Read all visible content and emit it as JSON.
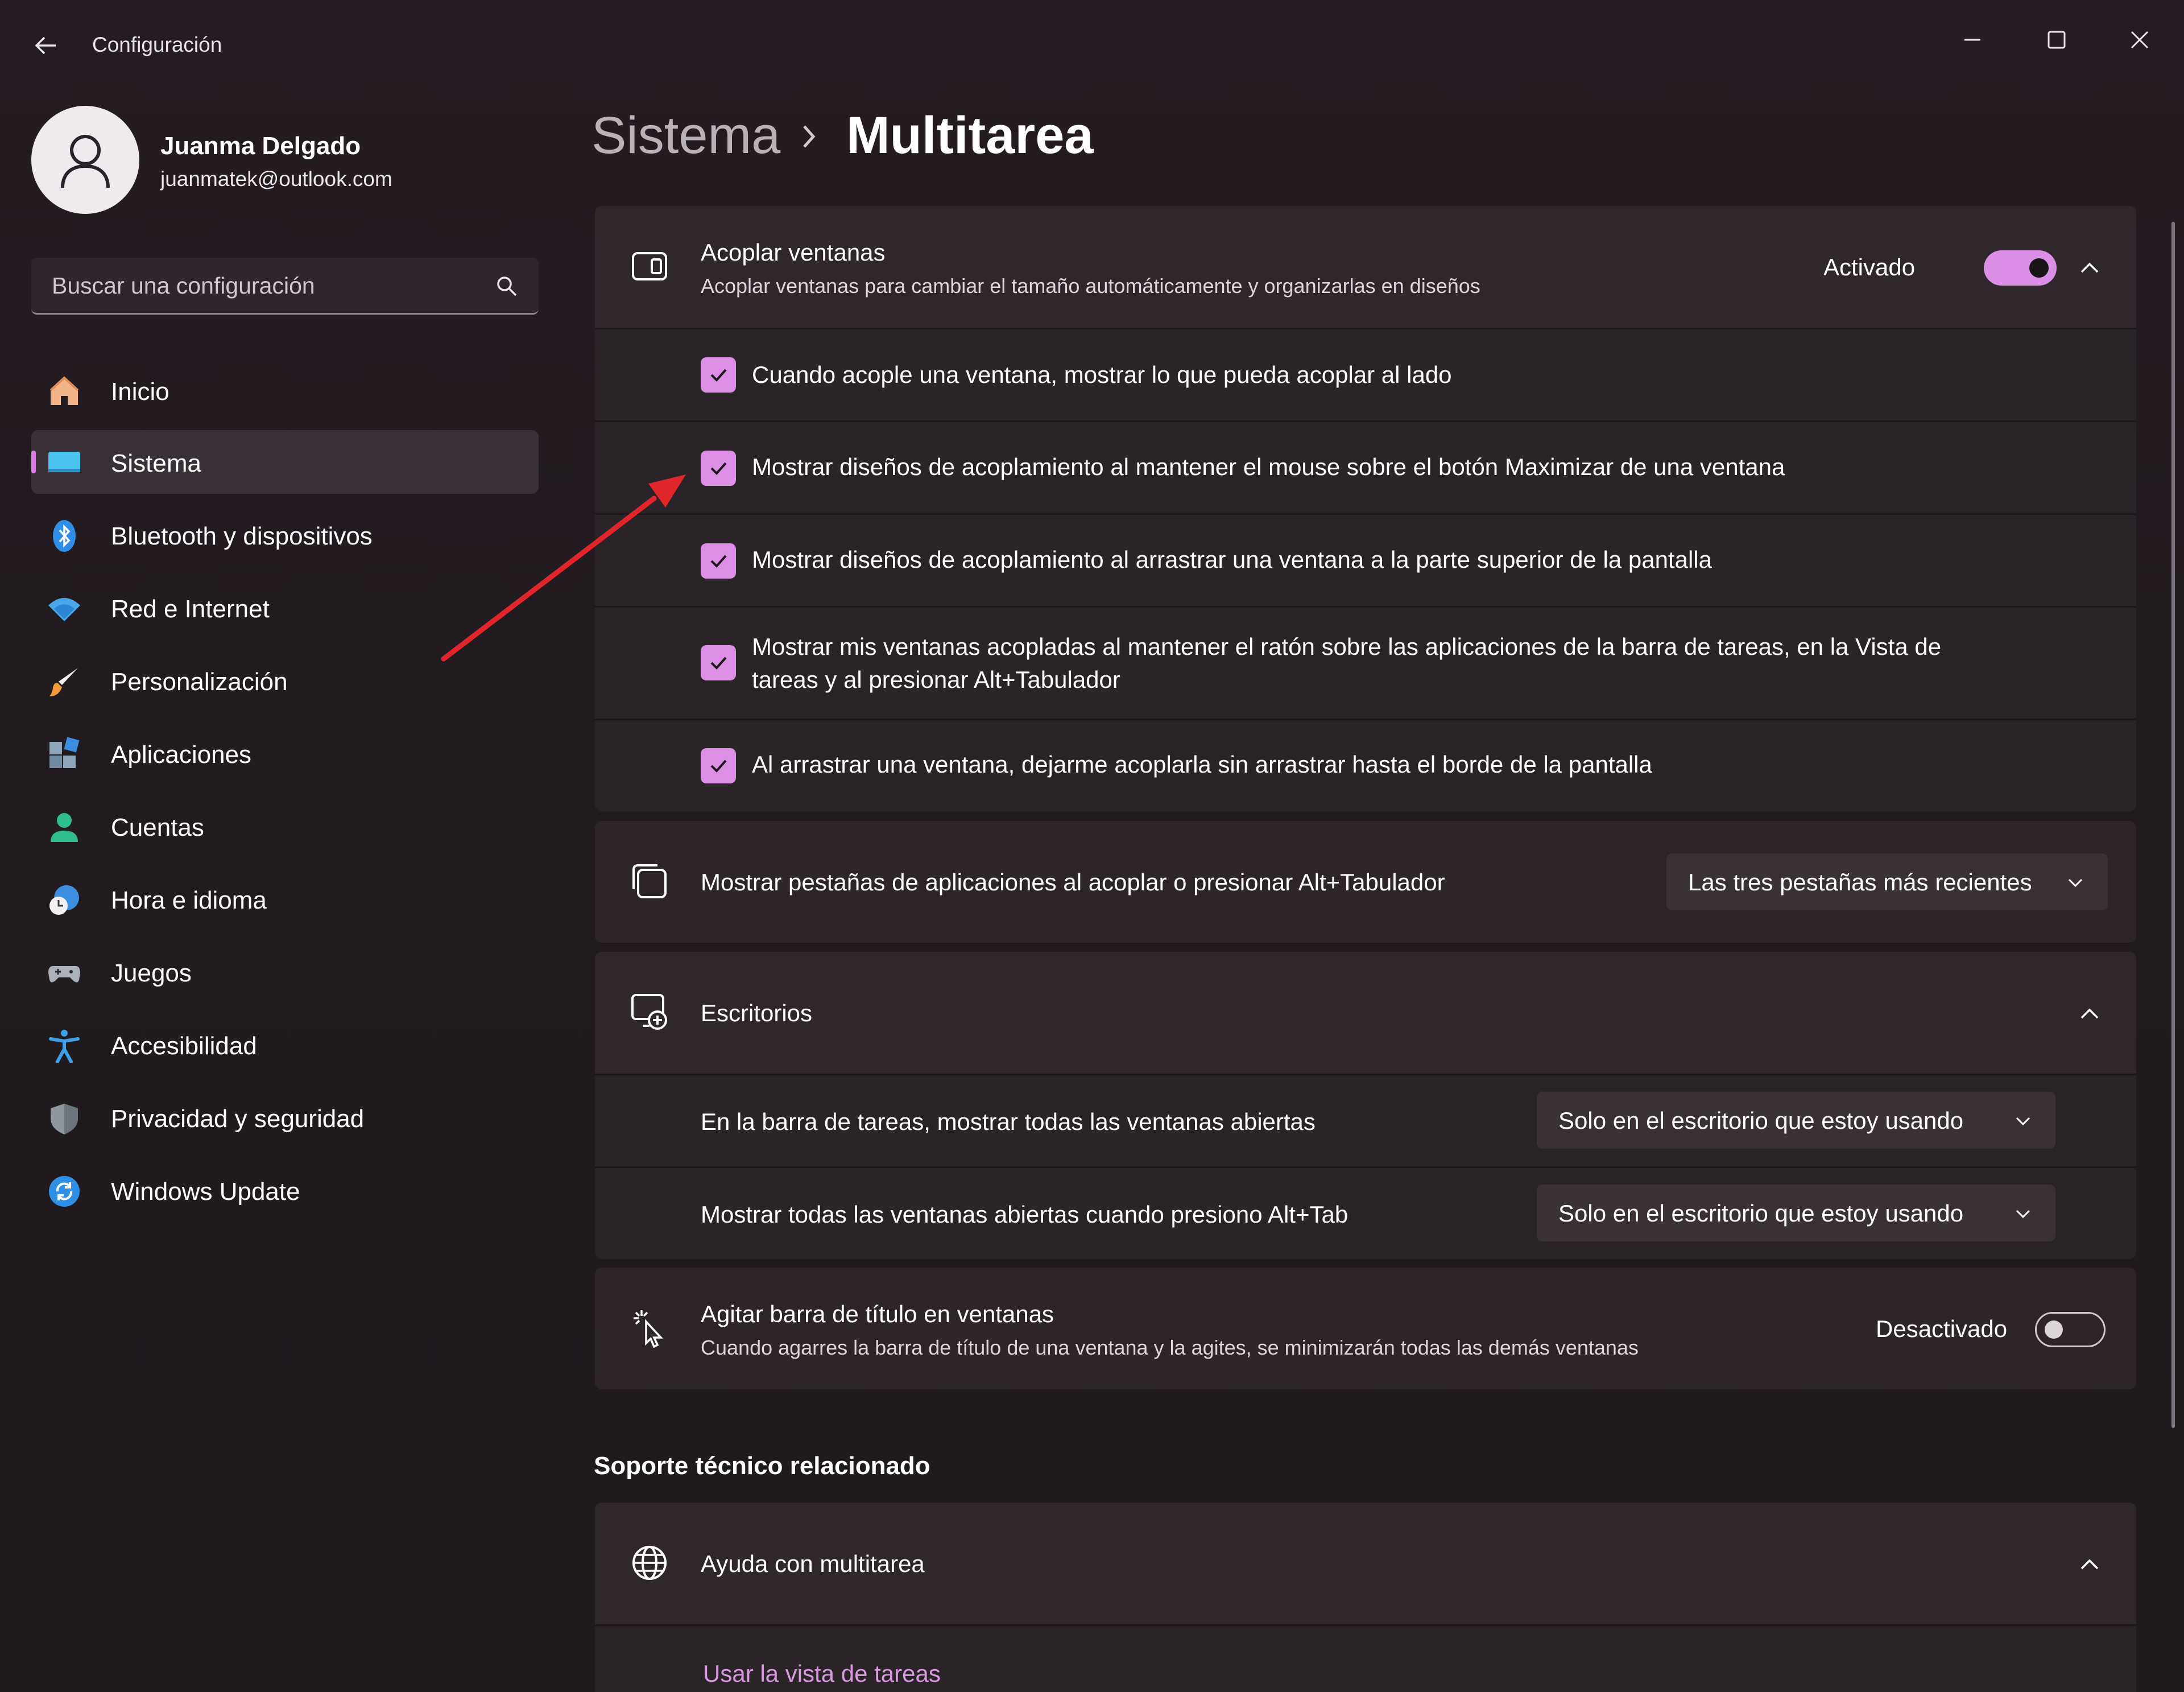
{
  "window": {
    "title": "Configuración"
  },
  "profile": {
    "name": "Juanma Delgado",
    "email": "juanmatek@outlook.com"
  },
  "search": {
    "placeholder": "Buscar una configuración"
  },
  "sidebar": {
    "items": [
      {
        "label": "Inicio",
        "icon": "home-icon"
      },
      {
        "label": "Sistema",
        "icon": "monitor-icon",
        "active": true
      },
      {
        "label": "Bluetooth y dispositivos",
        "icon": "bluetooth-icon"
      },
      {
        "label": "Red e Internet",
        "icon": "wifi-icon"
      },
      {
        "label": "Personalización",
        "icon": "paintbrush-icon"
      },
      {
        "label": "Aplicaciones",
        "icon": "apps-icon"
      },
      {
        "label": "Cuentas",
        "icon": "account-icon"
      },
      {
        "label": "Hora e idioma",
        "icon": "clock-globe-icon"
      },
      {
        "label": "Juegos",
        "icon": "gamepad-icon"
      },
      {
        "label": "Accesibilidad",
        "icon": "accessibility-icon"
      },
      {
        "label": "Privacidad y seguridad",
        "icon": "shield-icon"
      },
      {
        "label": "Windows Update",
        "icon": "update-icon"
      }
    ]
  },
  "breadcrumb": {
    "parent": "Sistema",
    "current": "Multitarea"
  },
  "snap": {
    "title": "Acoplar ventanas",
    "description": "Acoplar ventanas para cambiar el tamaño automáticamente y organizarlas en diseños",
    "state_label": "Activado",
    "enabled": true,
    "options": [
      {
        "label": "Cuando acople una ventana, mostrar lo que pueda acoplar al lado",
        "checked": true
      },
      {
        "label": "Mostrar diseños de acoplamiento al mantener el mouse sobre el botón Maximizar de una ventana",
        "checked": true
      },
      {
        "label": "Mostrar diseños de acoplamiento al arrastrar una ventana a la parte superior de la pantalla",
        "checked": true
      },
      {
        "label_line1": "Mostrar mis ventanas acopladas al mantener el ratón sobre las aplicaciones de la barra de tareas, en la Vista de",
        "label_line2": "tareas y al presionar Alt+Tabulador",
        "checked": true
      },
      {
        "label": "Al arrastrar una ventana, dejarme acoplarla sin arrastrar hasta el borde de la pantalla",
        "checked": true
      }
    ]
  },
  "tabs_setting": {
    "title": "Mostrar pestañas de aplicaciones al acoplar o presionar Alt+Tabulador",
    "value": "Las tres pestañas más recientes"
  },
  "desktops": {
    "title": "Escritorios",
    "rows": [
      {
        "label": "En la barra de tareas, mostrar todas las ventanas abiertas",
        "value": "Solo en el escritorio que estoy usando"
      },
      {
        "label": "Mostrar todas las ventanas abiertas cuando presiono Alt+Tab",
        "value": "Solo en el escritorio que estoy usando"
      }
    ]
  },
  "shake": {
    "title": "Agitar barra de título en ventanas",
    "description": "Cuando agarres la barra de título de una ventana y la agites, se minimizarán todas las demás ventanas",
    "state_label": "Desactivado",
    "enabled": false
  },
  "support": {
    "section_title": "Soporte técnico relacionado",
    "help_title": "Ayuda con multitarea",
    "link": "Usar la vista de tareas"
  },
  "colors": {
    "accent": "#db8ee6",
    "annotation_arrow": "#e0262b"
  }
}
